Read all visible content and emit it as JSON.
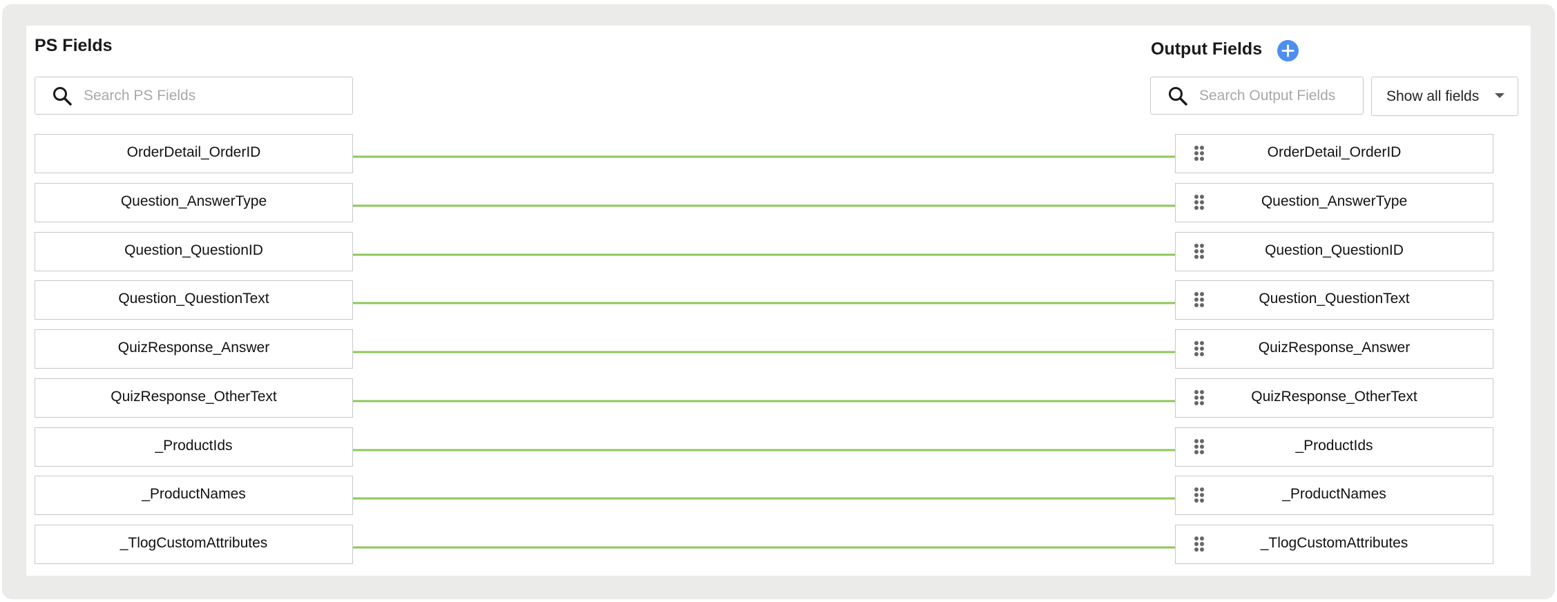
{
  "ps_panel": {
    "title": "PS Fields",
    "search_placeholder": "Search PS Fields"
  },
  "output_panel": {
    "title": "Output Fields",
    "add_icon": "plus-circle-icon",
    "search_placeholder": "Search Output Fields",
    "filter_selected": "Show all fields"
  },
  "colors": {
    "connector": "#8dc859",
    "add_button": "#4c8ff0"
  },
  "mappings": [
    {
      "source": "OrderDetail_OrderID",
      "target": "OrderDetail_OrderID"
    },
    {
      "source": "Question_AnswerType",
      "target": "Question_AnswerType"
    },
    {
      "source": "Question_QuestionID",
      "target": "Question_QuestionID"
    },
    {
      "source": "Question_QuestionText",
      "target": "Question_QuestionText"
    },
    {
      "source": "QuizResponse_Answer",
      "target": "QuizResponse_Answer"
    },
    {
      "source": "QuizResponse_OtherText",
      "target": "QuizResponse_OtherText"
    },
    {
      "source": "_ProductIds",
      "target": "_ProductIds"
    },
    {
      "source": "_ProductNames",
      "target": "_ProductNames"
    },
    {
      "source": "_TlogCustomAttributes",
      "target": "_TlogCustomAttributes"
    }
  ]
}
